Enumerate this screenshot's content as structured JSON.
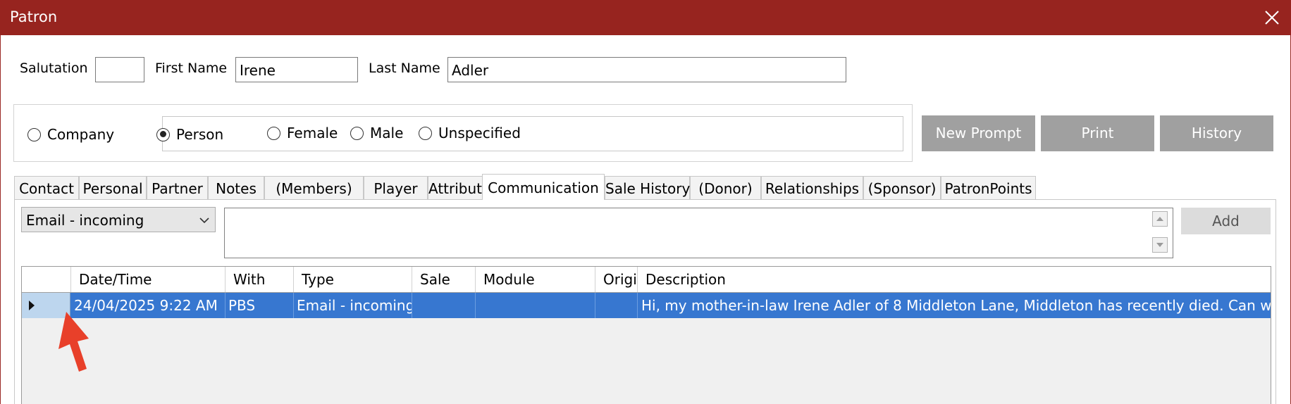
{
  "window": {
    "title": "Patron"
  },
  "name_fields": {
    "salutation_label": "Salutation",
    "salutation_value": "",
    "first_name_label": "First Name",
    "first_name_value": "Irene",
    "last_name_label": "Last Name",
    "last_name_value": "Adler"
  },
  "patron_type": {
    "options": [
      "Company",
      "Person"
    ],
    "selected": "Person"
  },
  "gender": {
    "options": [
      "Female",
      "Male",
      "Unspecified"
    ],
    "selected": ""
  },
  "buttons": {
    "new_prompt": "New Prompt",
    "print": "Print",
    "history": "History",
    "add": "Add"
  },
  "tabs": [
    {
      "label": "Contact"
    },
    {
      "label": "Personal"
    },
    {
      "label": "Partner"
    },
    {
      "label": "Notes"
    },
    {
      "label": "(Members)"
    },
    {
      "label": "Player"
    },
    {
      "label": "Attributes"
    },
    {
      "label": "Communication",
      "active": true
    },
    {
      "label": "Sale History"
    },
    {
      "label": "(Donor)"
    },
    {
      "label": "Relationships"
    },
    {
      "label": "(Sponsor)"
    },
    {
      "label": "PatronPoints"
    }
  ],
  "communication": {
    "type_selected": "Email - incoming",
    "memo_value": "",
    "columns": [
      "Date/Time",
      "With",
      "Type",
      "Sale",
      "Module",
      "Origi",
      "Description"
    ],
    "rows": [
      {
        "date_time": "24/04/2025 9:22 AM",
        "with": "PBS",
        "type": "Email - incoming",
        "sale": "",
        "module": "",
        "origin": "",
        "description": "Hi, my mother-in-law Irene Adler of 8 Middleton Lane, Middleton has recently died. Can we please",
        "selected": true
      }
    ]
  },
  "colors": {
    "titlebar": "#97241f",
    "selected_row": "#3777d0",
    "button_gray": "#a0a0a0",
    "annotation_arrow": "#e8402a"
  },
  "icons": {
    "close": "close-icon",
    "dropdown": "chevron-down-icon",
    "row_indicator": "row-pointer-icon",
    "annotation": "red-arrow-annotation"
  }
}
